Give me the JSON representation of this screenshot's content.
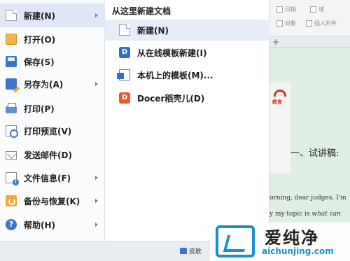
{
  "menu": {
    "items": [
      {
        "label": "新建(N)",
        "icon": "new-file-icon",
        "has_submenu": true,
        "active": true
      },
      {
        "label": "打开(O)",
        "icon": "folder-icon",
        "has_submenu": false
      },
      {
        "label": "保存(S)",
        "icon": "save-icon",
        "has_submenu": false
      },
      {
        "label": "另存为(A)",
        "icon": "save-as-icon",
        "has_submenu": true
      },
      {
        "label": "打印(P)",
        "icon": "printer-icon",
        "has_submenu": false
      },
      {
        "label": "打印预览(V)",
        "icon": "print-preview-icon",
        "has_submenu": false
      },
      {
        "label": "发送邮件(D)",
        "icon": "mail-icon",
        "has_submenu": false
      },
      {
        "label": "文件信息(F)",
        "icon": "file-info-icon",
        "has_submenu": true
      },
      {
        "label": "备份与恢复(K)",
        "icon": "backup-icon",
        "has_submenu": true
      },
      {
        "label": "帮助(H)",
        "icon": "help-icon",
        "has_submenu": true
      }
    ],
    "skin_label": "皮肤"
  },
  "submenu": {
    "title": "从这里新建文档",
    "items": [
      {
        "label": "新建(N)",
        "icon": "blank-doc-icon",
        "active": true
      },
      {
        "label": "从在线模板新建(I)",
        "icon": "online-template-icon"
      },
      {
        "label": "本机上的模板(M)...",
        "icon": "local-template-icon"
      },
      {
        "label": "Docer稻壳儿(D)",
        "icon": "docer-icon"
      }
    ]
  },
  "ribbon": {
    "date_label": "日期",
    "field_label": "域",
    "object_label": "对象",
    "attachment_label": "插入附件"
  },
  "tab_bar": {
    "add_label": "+"
  },
  "document": {
    "logo_text": "教育",
    "heading": "一、试讲稿:",
    "line1": "orning, dear judges. I'm",
    "line2_prefix": "y my topic is ",
    "line2_em": "what can"
  },
  "watermark": {
    "brand_cn": "爱纯净",
    "url": "aichunjing.com"
  },
  "colors": {
    "menu_active_bg": "#dfe7f7",
    "submenu_active_bg": "#e6ecf8",
    "doc_bg": "#dfeee2",
    "watermark_blue": "#1b8ed0"
  }
}
